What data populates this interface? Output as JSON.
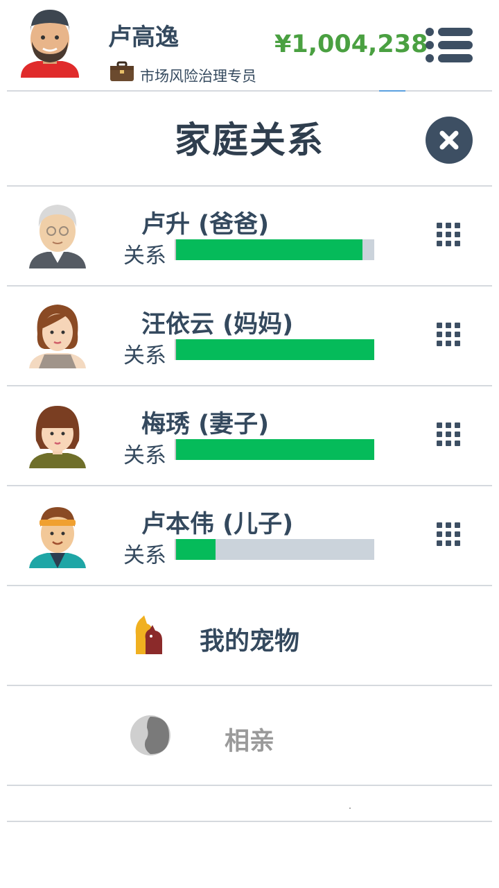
{
  "header": {
    "name": "卢高逸",
    "job": "市场风险治理专员",
    "money": "¥1,004,238",
    "icons": {
      "avatar": "man-cap-avatar",
      "job": "briefcase-icon",
      "menu": "menu-icon"
    }
  },
  "panel": {
    "title": "家庭关系",
    "close_icon": "close-icon"
  },
  "family": [
    {
      "name": "卢升 (爸爸)",
      "relation_label": "关系",
      "relation": 0.94,
      "avatar": "grandpa-avatar"
    },
    {
      "name": "汪依云 (妈妈)",
      "relation_label": "关系",
      "relation": 1.0,
      "avatar": "woman-avatar"
    },
    {
      "name": "梅琇 (妻子)",
      "relation_label": "关系",
      "relation": 1.0,
      "avatar": "wife-avatar"
    },
    {
      "name": "卢本伟 (儿子)",
      "relation_label": "关系",
      "relation": 0.2,
      "avatar": "boy-headband-avatar"
    }
  ],
  "options": {
    "pets": {
      "label": "我的宠物",
      "icon": "pets-icon"
    },
    "blind_date": {
      "label": "相亲",
      "icon": "couple-icon"
    }
  },
  "colors": {
    "bar_fill": "#05bb5a",
    "bar_track": "#cbd3db",
    "money": "#4aa041",
    "text": "#34495e",
    "disabled": "#9a9a9a"
  }
}
